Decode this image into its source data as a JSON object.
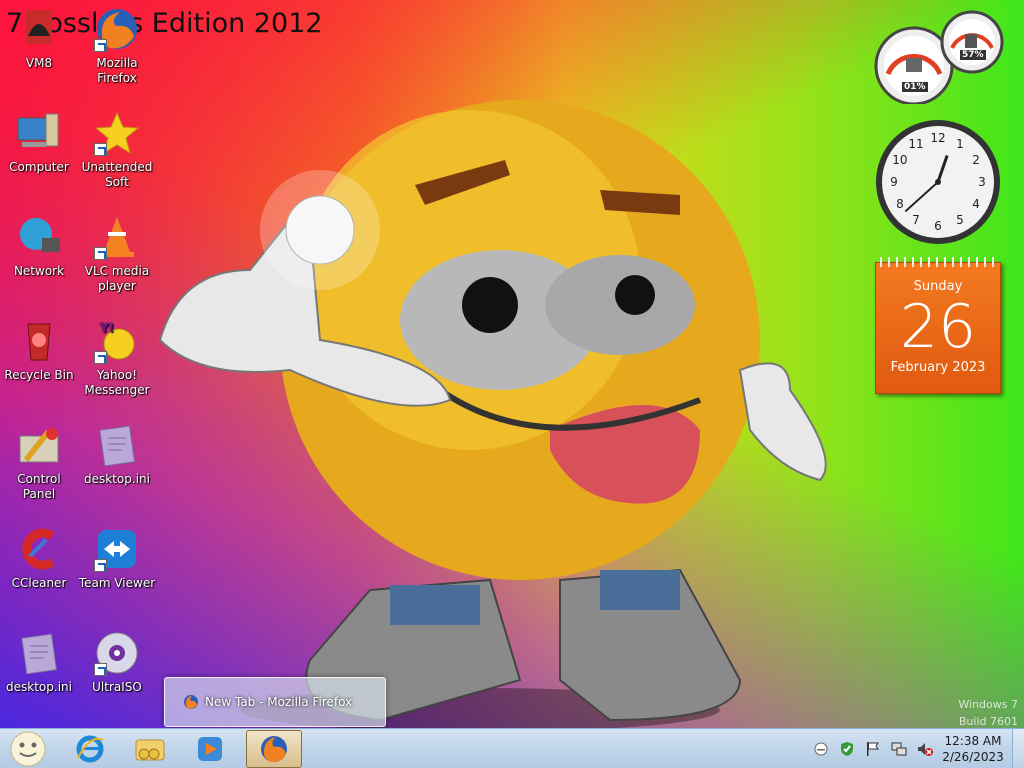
{
  "desktop": {
    "title_watermark": "7 Lossless Edition 2012",
    "icons": [
      {
        "label": "VM8",
        "icon": "vm8-icon"
      },
      {
        "label": "Mozilla Firefox",
        "icon": "firefox-icon"
      },
      {
        "label": "Computer",
        "icon": "computer-icon"
      },
      {
        "label": "Unattended Soft",
        "icon": "star-icon"
      },
      {
        "label": "Network",
        "icon": "network-icon"
      },
      {
        "label": "VLC media player",
        "icon": "vlc-icon"
      },
      {
        "label": "Recycle Bin",
        "icon": "recycle-bin-icon"
      },
      {
        "label": "Yahoo! Messenger",
        "icon": "yahoo-messenger-icon"
      },
      {
        "label": "Control Panel",
        "icon": "control-panel-icon"
      },
      {
        "label": "desktop.ini",
        "icon": "ini-file-icon"
      },
      {
        "label": "CCleaner",
        "icon": "ccleaner-icon"
      },
      {
        "label": "Team Viewer",
        "icon": "teamviewer-icon"
      },
      {
        "label": "desktop.ini",
        "icon": "ini-file-icon"
      },
      {
        "label": "UltraISO",
        "icon": "ultraiso-icon"
      }
    ],
    "build_watermark": {
      "line1": "Windows 7",
      "line2": "Build 7601"
    }
  },
  "gadgets": {
    "cpu_meter": {
      "cpu_percent": "01%",
      "memory_percent": "57%"
    },
    "clock": {
      "hour": 12,
      "minute": 38
    },
    "calendar": {
      "weekday": "Sunday",
      "day": "26",
      "month_year": "February 2023"
    }
  },
  "thumbnail_popup": {
    "title": "New Tab - Mozilla Firefox"
  },
  "taskbar": {
    "pinned": [
      "start-orb",
      "internet-explorer-icon",
      "windows-explorer-icon",
      "windows-media-player-icon",
      "firefox-icon"
    ],
    "active": "firefox-icon",
    "clock": {
      "time": "12:38 AM",
      "date": "2/26/2023"
    }
  },
  "colors": {
    "taskbar": "#c2d6ea",
    "calendar": "#f47a20"
  }
}
